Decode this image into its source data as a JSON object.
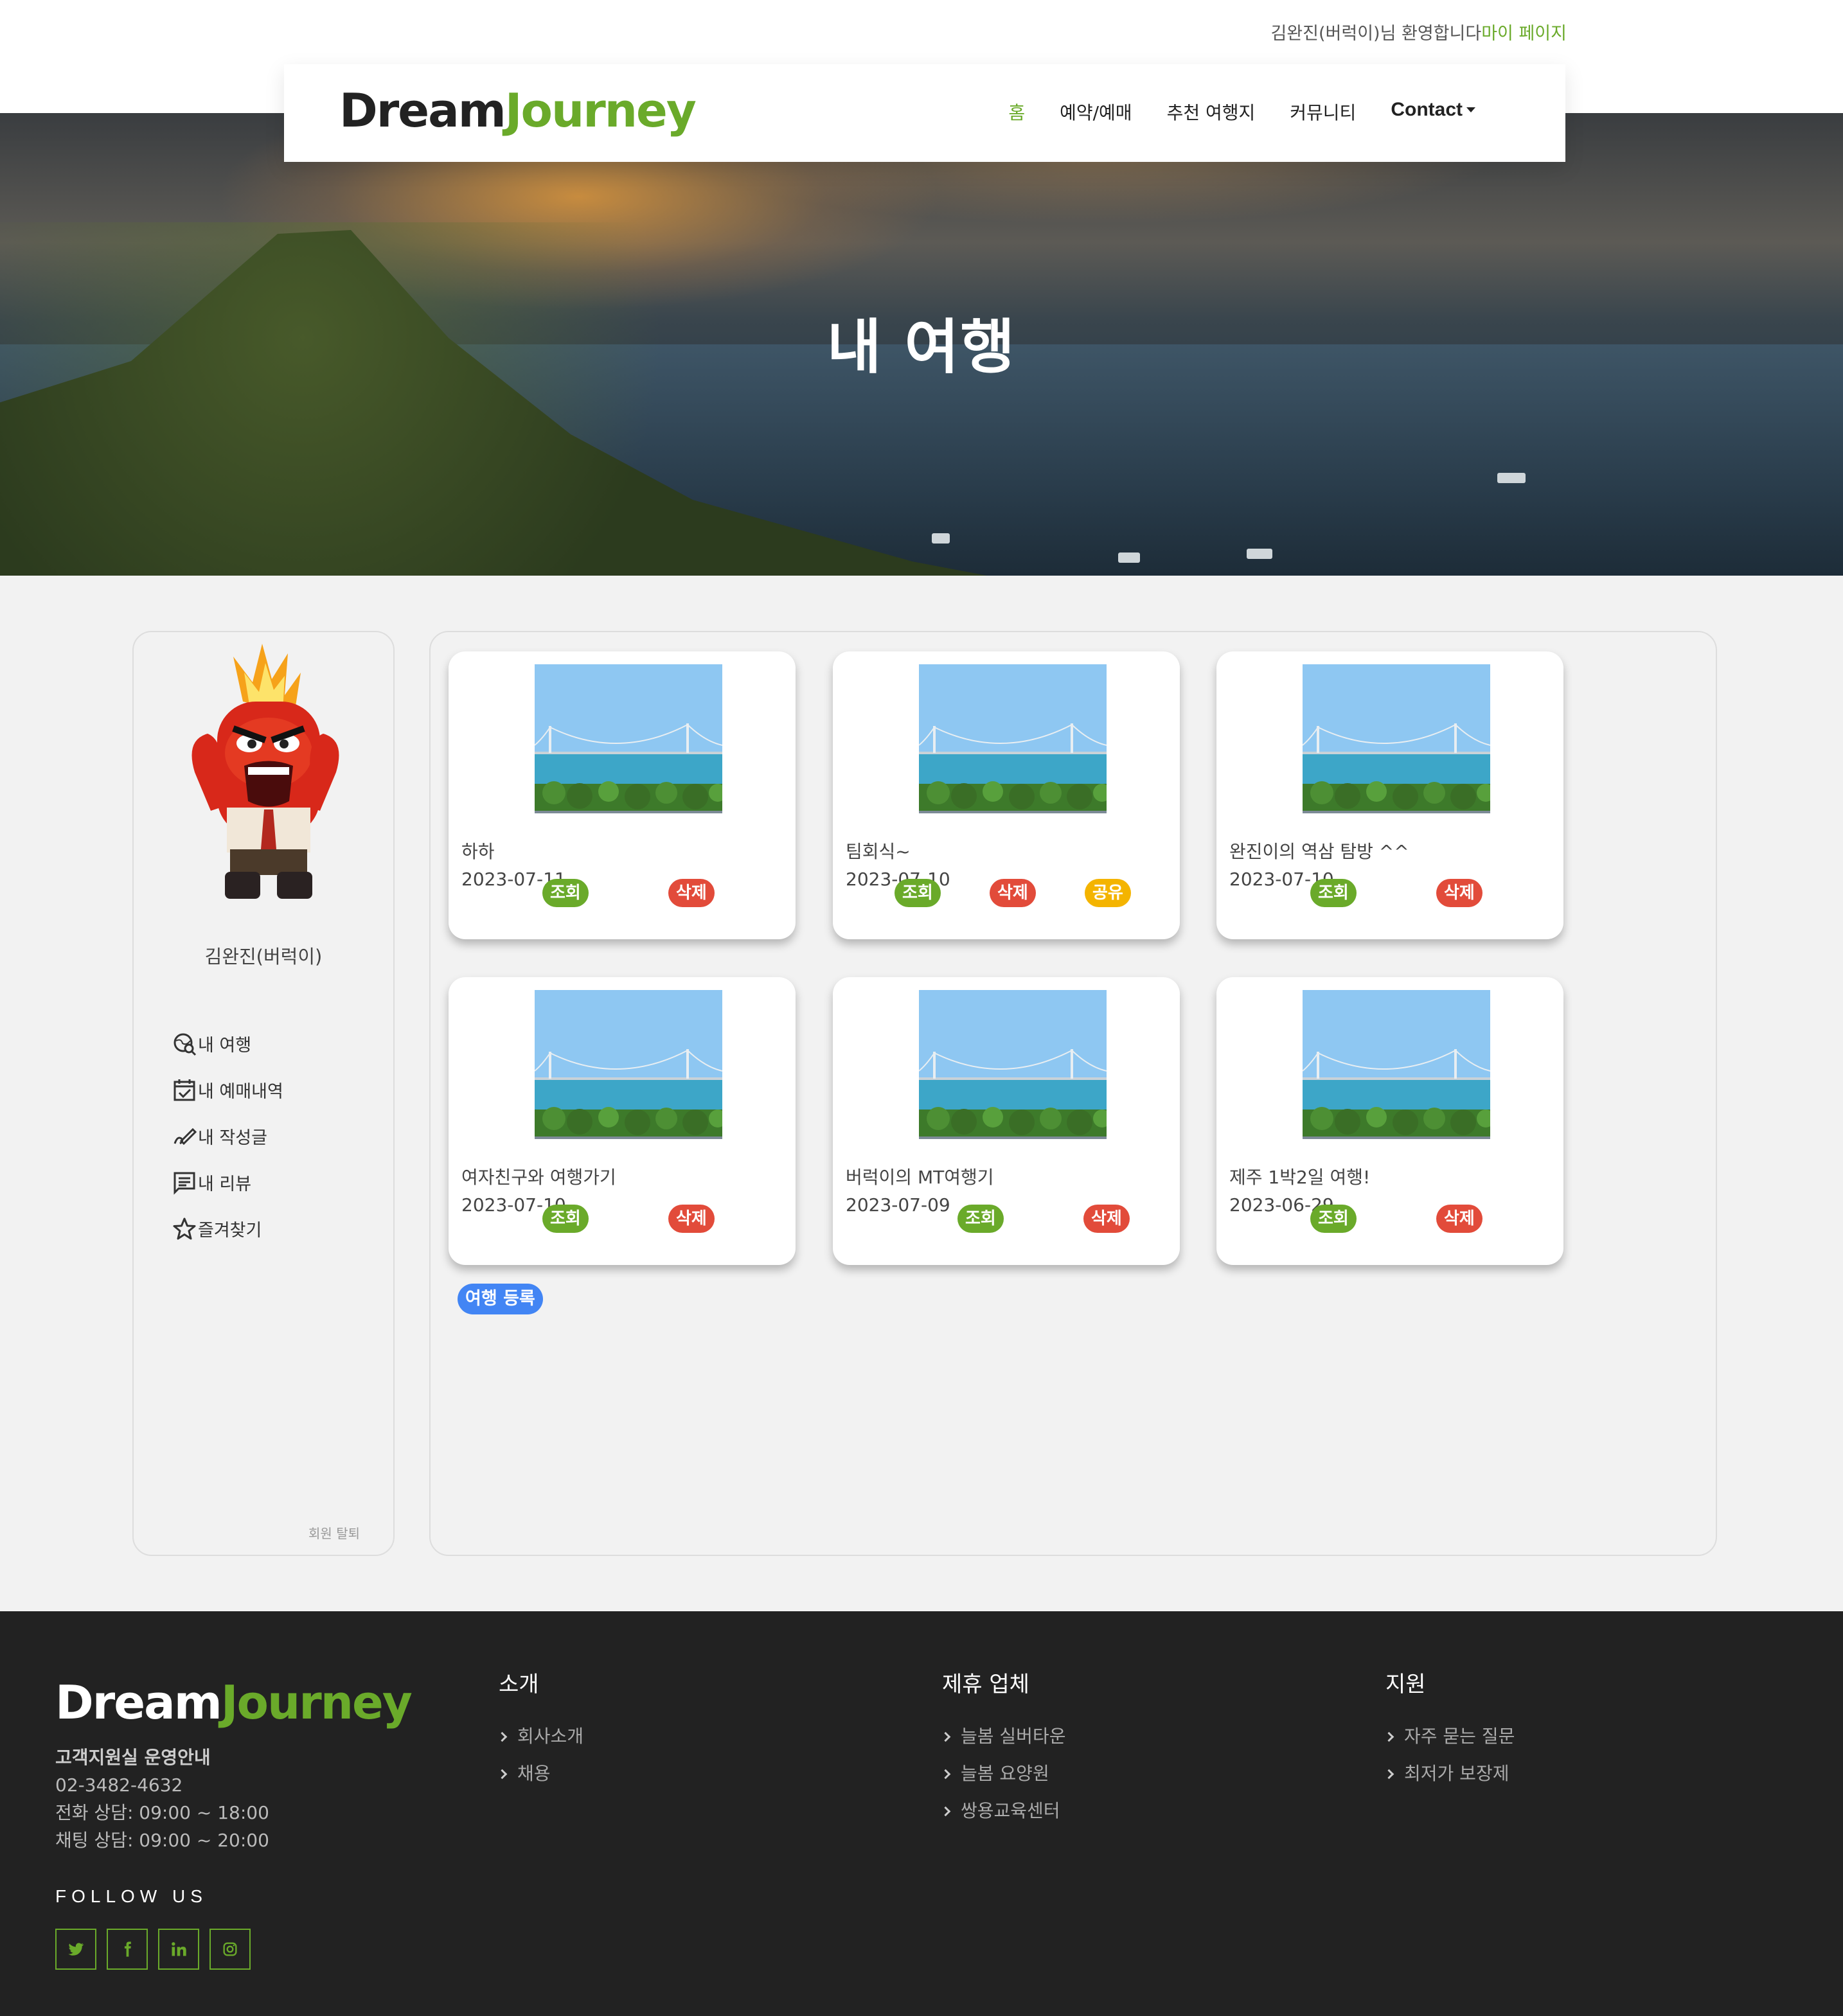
{
  "header": {
    "welcome_text": "김완진(버럭이)님 환영합니다",
    "mypage_link": "마이 페이지",
    "logo_part1": "Dream",
    "logo_part2": "Journey",
    "nav": [
      "홈",
      "예약/예매",
      "추천 여행지",
      "커뮤니티",
      "Contact"
    ]
  },
  "hero": {
    "title": "내 여행"
  },
  "sidebar": {
    "username": "김완진(버럭이)",
    "menu": [
      {
        "label": "내 여행",
        "icon": "travel-search-icon"
      },
      {
        "label": "내 예매내역",
        "icon": "calendar-check-icon"
      },
      {
        "label": "내 작성글",
        "icon": "pencil-icon"
      },
      {
        "label": "내 리뷰",
        "icon": "review-icon"
      },
      {
        "label": "즐겨찾기",
        "icon": "star-icon"
      }
    ],
    "withdraw": "회원 탈퇴"
  },
  "trips": [
    {
      "title": "하하",
      "date": "2023-07-11",
      "buttons": [
        "조회",
        "삭제"
      ]
    },
    {
      "title": "팀회식~",
      "date": "2023-07-10",
      "buttons": [
        "조회",
        "삭제",
        "공유"
      ]
    },
    {
      "title": "완진이의 역삼 탐방 ^^",
      "date": "2023-07-10",
      "buttons": [
        "조회",
        "삭제"
      ]
    },
    {
      "title": "여자친구와 여행가기",
      "date": "2023-07-10",
      "buttons": [
        "조회",
        "삭제"
      ]
    },
    {
      "title": "버럭이의 MT여행기",
      "date": "2023-07-09",
      "buttons": [
        "조회",
        "삭제"
      ]
    },
    {
      "title": "제주 1박2일 여행!",
      "date": "2023-06-29",
      "buttons": [
        "조회",
        "삭제"
      ]
    }
  ],
  "register_button": "여행 등록",
  "footer": {
    "logo_part1": "Dream",
    "logo_part2": "Journey",
    "support_title": "고객지원실 운영안내",
    "phone": "02-3482-4632",
    "phone_hours": "전화 상담: 09:00 ~ 18:00",
    "chat_hours": "채팅 상담: 09:00 ~ 20:00",
    "follow": "FOLLOW US",
    "social_icons": [
      "twitter-icon",
      "facebook-icon",
      "linkedin-icon",
      "instagram-icon"
    ],
    "columns": [
      {
        "title": "소개",
        "links": [
          "회사소개",
          "채용"
        ]
      },
      {
        "title": "제휴 업체",
        "links": [
          "늘봄 실버타운",
          "늘봄 요양원",
          "쌍용교육센터"
        ]
      },
      {
        "title": "지원",
        "links": [
          "자주 묻는 질문",
          "최저가 보장제"
        ]
      }
    ]
  },
  "colors": {
    "accent": "#6aaa2a",
    "delete": "#e24b3a",
    "share": "#f4b400",
    "register": "#4285f4",
    "footer_bg": "#222222"
  }
}
